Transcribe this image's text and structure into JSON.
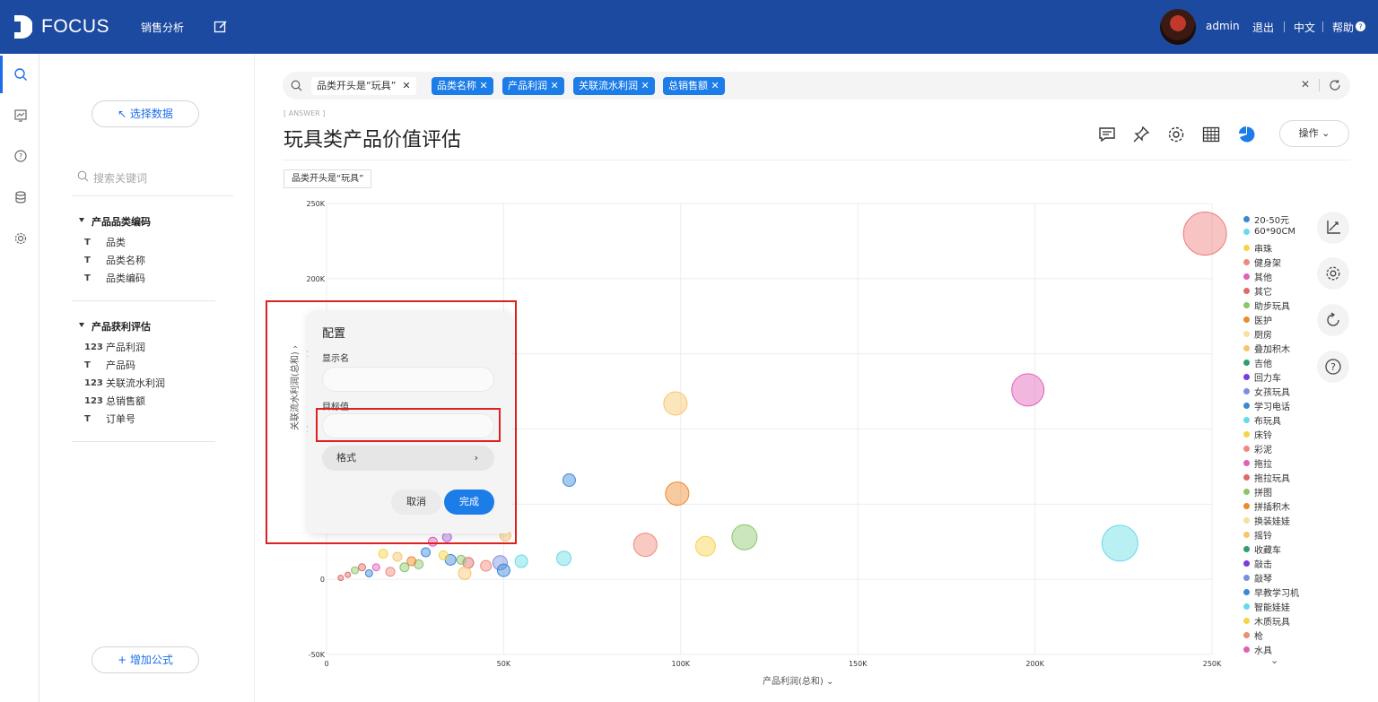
{
  "app": {
    "logo_text": "FOCUS",
    "nav_sales": "销售分析",
    "user": "admin",
    "logout": "退出",
    "lang": "中文",
    "help": "帮助"
  },
  "panel": {
    "select_data": "↖ 选择数据",
    "search_placeholder": "搜索关键词",
    "groups": [
      {
        "title": "产品品类编码",
        "fields": [
          {
            "type": "T",
            "name": "品类"
          },
          {
            "type": "T",
            "name": "品类名称"
          },
          {
            "type": "T",
            "name": "品类编码"
          }
        ]
      },
      {
        "title": "产品获利评估",
        "fields": [
          {
            "type": "123",
            "name": "产品利润"
          },
          {
            "type": "T",
            "name": "产品码"
          },
          {
            "type": "123",
            "name": "关联流水利润"
          },
          {
            "type": "123",
            "name": "总销售额"
          },
          {
            "type": "T",
            "name": "订单号"
          }
        ]
      }
    ],
    "add_formula": "+ 增加公式"
  },
  "search": {
    "condition": "品类开头是“玩具”",
    "chips": [
      "品类名称",
      "产品利润",
      "关联流水利润",
      "总销售额"
    ]
  },
  "answer_tag": "[ ANSWER ]",
  "page_title": "玩具类产品价值评估",
  "ops_label": "操作",
  "filter_chip": "品类开头是“玩具”",
  "popup": {
    "title": "配置",
    "display_name_label": "显示名",
    "display_name_value": "",
    "target_label": "目标值",
    "target_value": "",
    "format_label": "格式",
    "cancel": "取消",
    "ok": "完成"
  },
  "chart_data": {
    "type": "scatter",
    "xlabel": "产品利润(总和)",
    "ylabel": "关联流水利润(总和)",
    "xlim": [
      0,
      250000
    ],
    "ylim": [
      -50000,
      250000
    ],
    "xticks": [
      "0",
      "50K",
      "100K",
      "150K",
      "200K",
      "250K"
    ],
    "yticks": [
      "-50K",
      "0",
      "50K",
      "100K",
      "150K",
      "200K",
      "250K"
    ],
    "grid": true,
    "legend_position": "right",
    "points": [
      {
        "x": 248000,
        "y": 230000,
        "size": 24,
        "color": "#ee7b7b"
      },
      {
        "x": 198000,
        "y": 126000,
        "size": 18,
        "color": "#e060b8"
      },
      {
        "x": 98500,
        "y": 117000,
        "size": 13,
        "color": "#f7c56b"
      },
      {
        "x": 68500,
        "y": 66000,
        "size": 7,
        "color": "#3a88d6"
      },
      {
        "x": 99000,
        "y": 57000,
        "size": 13,
        "color": "#f08a2c"
      },
      {
        "x": 118000,
        "y": 28000,
        "size": 14,
        "color": "#8cc56a"
      },
      {
        "x": 224000,
        "y": 24000,
        "size": 20,
        "color": "#66dbe6"
      },
      {
        "x": 90000,
        "y": 23000,
        "size": 13,
        "color": "#f08a7a"
      },
      {
        "x": 107000,
        "y": 22000,
        "size": 11,
        "color": "#f7d34a"
      },
      {
        "x": 67000,
        "y": 14000,
        "size": 8,
        "color": "#66dbe6"
      },
      {
        "x": 55000,
        "y": 12000,
        "size": 7,
        "color": "#66dbe6"
      },
      {
        "x": 49000,
        "y": 11000,
        "size": 8,
        "color": "#7d8fe0"
      },
      {
        "x": 50000,
        "y": 6000,
        "size": 7,
        "color": "#3a88d6"
      },
      {
        "x": 45000,
        "y": 9000,
        "size": 6,
        "color": "#f08a7a"
      },
      {
        "x": 40000,
        "y": 11000,
        "size": 6,
        "color": "#e06a6a"
      },
      {
        "x": 38000,
        "y": 13000,
        "size": 5,
        "color": "#8cc56a"
      },
      {
        "x": 35000,
        "y": 13000,
        "size": 6,
        "color": "#3a88d6"
      },
      {
        "x": 33000,
        "y": 16000,
        "size": 5,
        "color": "#f7d34a"
      },
      {
        "x": 28000,
        "y": 18000,
        "size": 5,
        "color": "#3a88d6"
      },
      {
        "x": 26000,
        "y": 10000,
        "size": 5,
        "color": "#8cc56a"
      },
      {
        "x": 24000,
        "y": 12000,
        "size": 5,
        "color": "#f08a2c"
      },
      {
        "x": 22000,
        "y": 8000,
        "size": 5,
        "color": "#8cc56a"
      },
      {
        "x": 20000,
        "y": 15000,
        "size": 5,
        "color": "#f7c56b"
      },
      {
        "x": 18000,
        "y": 5000,
        "size": 5,
        "color": "#f08a7a"
      },
      {
        "x": 16000,
        "y": 17000,
        "size": 5,
        "color": "#f7d34a"
      },
      {
        "x": 14000,
        "y": 8000,
        "size": 4,
        "color": "#e060b8"
      },
      {
        "x": 12000,
        "y": 4000,
        "size": 4,
        "color": "#3a88d6"
      },
      {
        "x": 10000,
        "y": 8000,
        "size": 4,
        "color": "#e06a6a"
      },
      {
        "x": 8000,
        "y": 6000,
        "size": 4,
        "color": "#8cc56a"
      },
      {
        "x": 6000,
        "y": 3000,
        "size": 3,
        "color": "#e06a6a"
      },
      {
        "x": 4000,
        "y": 1000,
        "size": 3,
        "color": "#e06a6a"
      },
      {
        "x": 39000,
        "y": 4000,
        "size": 7,
        "color": "#f7c56b"
      },
      {
        "x": 30000,
        "y": 25000,
        "size": 5,
        "color": "#e060b8"
      },
      {
        "x": 34000,
        "y": 28000,
        "size": 5,
        "color": "#b06ae0"
      },
      {
        "x": 50500,
        "y": 29000,
        "size": 6,
        "color": "#f7c56b"
      }
    ],
    "legend": [
      {
        "name": "20-50元",
        "color": "#3a88d6"
      },
      {
        "name": "60*90CM",
        "color": "#66dbe6"
      },
      {
        "name": "串珠",
        "color": "#f7d34a"
      },
      {
        "name": "健身架",
        "color": "#f08a7a"
      },
      {
        "name": "其他",
        "color": "#e060b8"
      },
      {
        "name": "其它",
        "color": "#e06a6a"
      },
      {
        "name": "助步玩具",
        "color": "#8cc56a"
      },
      {
        "name": "医护",
        "color": "#f08a2c"
      },
      {
        "name": "厨房",
        "color": "#f7e0a0"
      },
      {
        "name": "叠加积木",
        "color": "#f7c56b"
      },
      {
        "name": "吉他",
        "color": "#2f9e6a"
      },
      {
        "name": "回力车",
        "color": "#7a3ae0"
      },
      {
        "name": "女孩玩具",
        "color": "#7d8fe0"
      },
      {
        "name": "学习电话",
        "color": "#3a88d6"
      },
      {
        "name": "布玩具",
        "color": "#66dbe6"
      },
      {
        "name": "床铃",
        "color": "#f7d34a"
      },
      {
        "name": "彩泥",
        "color": "#f08a7a"
      },
      {
        "name": "拖拉",
        "color": "#e060b8"
      },
      {
        "name": "拖拉玩具",
        "color": "#e06a6a"
      },
      {
        "name": "拼图",
        "color": "#8cc56a"
      },
      {
        "name": "拼插积木",
        "color": "#f08a2c"
      },
      {
        "name": "换装娃娃",
        "color": "#f7e0a0"
      },
      {
        "name": "摇铃",
        "color": "#f7c56b"
      },
      {
        "name": "收藏车",
        "color": "#2f9e6a"
      },
      {
        "name": "敲击",
        "color": "#7a3ae0"
      },
      {
        "name": "敲琴",
        "color": "#7d8fe0"
      },
      {
        "name": "早教学习机",
        "color": "#3a88d6"
      },
      {
        "name": "智能娃娃",
        "color": "#66dbe6"
      },
      {
        "name": "木质玩具",
        "color": "#f7d34a"
      },
      {
        "name": "枪",
        "color": "#f08a7a"
      },
      {
        "name": "水具",
        "color": "#e060b8"
      }
    ]
  }
}
